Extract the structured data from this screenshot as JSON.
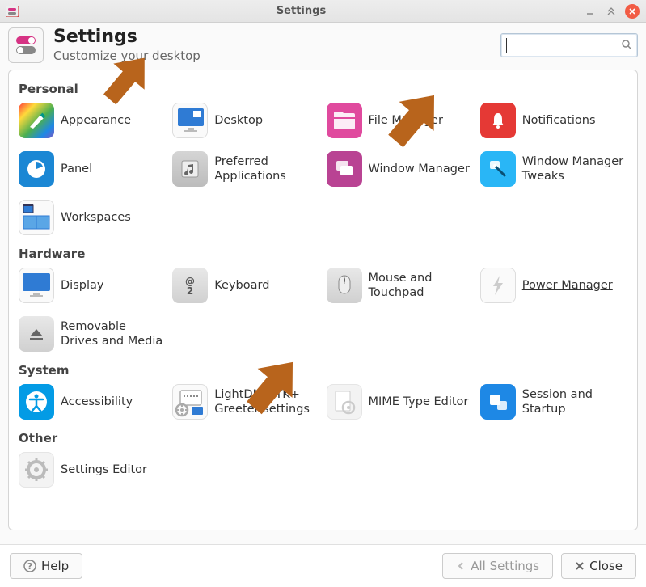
{
  "titlebar": {
    "title": "Settings"
  },
  "header": {
    "title": "Settings",
    "subtitle": "Customize your desktop"
  },
  "search": {
    "placeholder": ""
  },
  "categories": {
    "personal": "Personal",
    "hardware": "Hardware",
    "system": "System",
    "other": "Other"
  },
  "items": {
    "appearance": "Appearance",
    "desktop": "Desktop",
    "file_manager": "File Manager",
    "notifications": "Notifications",
    "panel": "Panel",
    "preferred_apps": "Preferred Applications",
    "window_manager": "Window Manager",
    "wm_tweaks": "Window Manager Tweaks",
    "workspaces": "Workspaces",
    "display": "Display",
    "keyboard": "Keyboard",
    "mouse": "Mouse and Touchpad",
    "power": "Power Manager",
    "removable": "Removable Drives and Media",
    "accessibility": "Accessibility",
    "lightdm": "LightDM GTK+ Greeter settings",
    "mime": "MIME Type Editor",
    "session": "Session and Startup",
    "settings_editor": "Settings Editor"
  },
  "footer": {
    "help": "Help",
    "all_settings": "All Settings",
    "close": "Close"
  }
}
